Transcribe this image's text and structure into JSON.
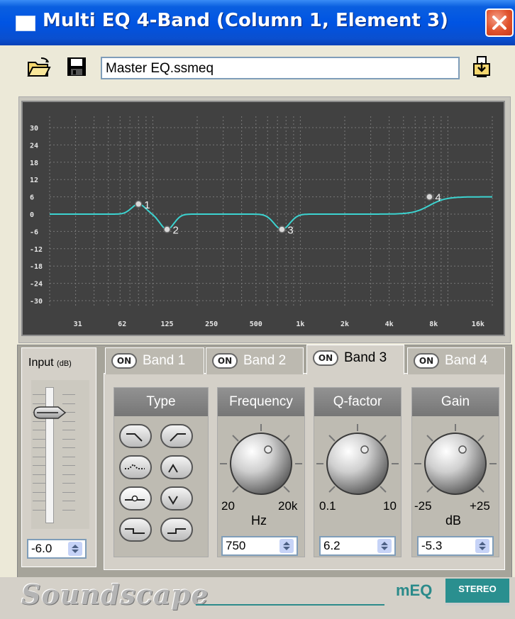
{
  "window": {
    "title": "Multi EQ 4-Band (Column 1, Element 3)",
    "accent": "#0054e3"
  },
  "toolbar": {
    "open_icon": "folder-open-icon",
    "save_icon": "floppy-save-icon",
    "preset_name": "Master EQ.ssmeq",
    "store_icon": "store-preset-icon"
  },
  "graph": {
    "y_ticks": [
      "30",
      "24",
      "18",
      "12",
      "6",
      "0",
      "-6",
      "-12",
      "-18",
      "-24",
      "-30"
    ],
    "x_ticks": [
      "31",
      "62",
      "125",
      "250",
      "500",
      "1k",
      "2k",
      "4k",
      "8k",
      "16k"
    ],
    "curve_color": "#3cd3d0",
    "bands": [
      {
        "label": "1",
        "freq_hz": 80,
        "gain_db": 3.5
      },
      {
        "label": "2",
        "freq_hz": 125,
        "gain_db": -5.3
      },
      {
        "label": "3",
        "freq_hz": 750,
        "gain_db": -5.3
      },
      {
        "label": "4",
        "freq_hz": 7500,
        "gain_db": 6
      }
    ]
  },
  "input": {
    "label": "Input",
    "unit": "(dB)",
    "value": "-6.0"
  },
  "tabs": [
    {
      "on": "ON",
      "label": "Band 1",
      "active": false
    },
    {
      "on": "ON",
      "label": "Band 2",
      "active": false
    },
    {
      "on": "ON",
      "label": "Band 3",
      "active": true
    },
    {
      "on": "ON",
      "label": "Band 4",
      "active": false
    }
  ],
  "sections": {
    "type": {
      "title": "Type"
    },
    "frequency": {
      "title": "Frequency",
      "min": "20",
      "max": "20k",
      "unit": "Hz",
      "value": "750"
    },
    "qfactor": {
      "title": "Q-factor",
      "min": "0.1",
      "max": "10",
      "value": "6.2"
    },
    "gain": {
      "title": "Gain",
      "min": "-25",
      "max": "+25",
      "unit": "dB",
      "value": "-5.3"
    }
  },
  "filter_types": [
    "low-pass-filter-icon",
    "high-pass-filter-icon",
    "notch-filter-icon",
    "bandpass-filter-icon",
    "peak-filter-icon",
    "peak-cut-filter-icon",
    "low-shelf-filter-icon",
    "high-shelf-filter-icon"
  ],
  "footer": {
    "brand": "Soundscape",
    "product": "mEQ",
    "mode": "STEREO",
    "brand_color": "#2a8f8f"
  }
}
